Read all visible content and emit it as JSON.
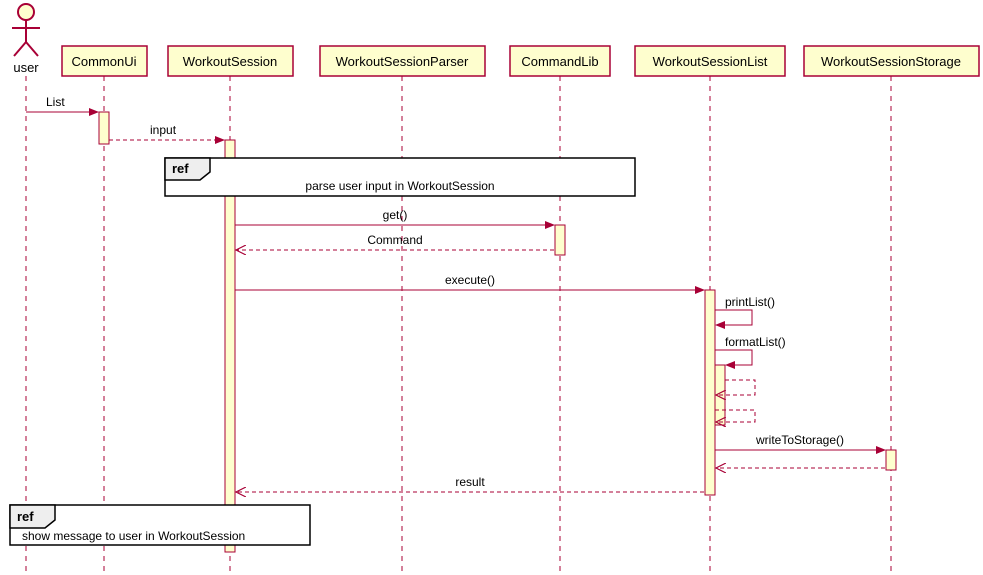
{
  "actor": {
    "label": "user"
  },
  "participants": [
    {
      "id": "commonui",
      "label": "CommonUi"
    },
    {
      "id": "workoutsession",
      "label": "WorkoutSession"
    },
    {
      "id": "parser",
      "label": "WorkoutSessionParser"
    },
    {
      "id": "commandlib",
      "label": "CommandLib"
    },
    {
      "id": "list",
      "label": "WorkoutSessionList"
    },
    {
      "id": "storage",
      "label": "WorkoutSessionStorage"
    }
  ],
  "messages": {
    "m1": "List",
    "m2": "input",
    "m3": "get()",
    "m4": "Command",
    "m5": "execute()",
    "m6": "printList()",
    "m7": "formatList()",
    "m8": "writeToStorage()",
    "m9": "result"
  },
  "refs": {
    "r1_label": "ref",
    "r1_text": "parse user input in WorkoutSession",
    "r2_label": "ref",
    "r2_text": "show message to user in WorkoutSession"
  }
}
